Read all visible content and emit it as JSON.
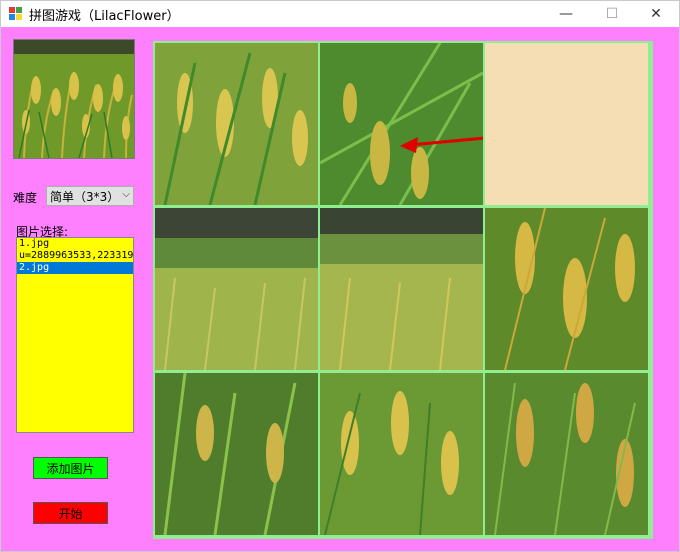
{
  "window": {
    "title": "拼图游戏（LilacFlower）",
    "minimize_glyph": "—",
    "maximize_glyph": "☐",
    "close_glyph": "✕"
  },
  "difficulty": {
    "label": "难度",
    "selected": "简单（3*3）"
  },
  "image_select": {
    "label": "图片选择:",
    "items": [
      "1.jpg",
      "u=2889963533,223319",
      "2.jpg"
    ],
    "selected_index": 2
  },
  "buttons": {
    "add_image": "添加图片",
    "start": "开始"
  },
  "board": {
    "grid": "3x3",
    "empty_tile": "top-right"
  },
  "colors": {
    "background": "#ff80ff",
    "listbox": "#ffff00",
    "add_button": "#00ff00",
    "start_button": "#ff0000",
    "board_border": "#90ee90",
    "empty_tile": "#f5deb3",
    "list_selection": "#0078d7",
    "annotation_arrow": "#e00000"
  }
}
